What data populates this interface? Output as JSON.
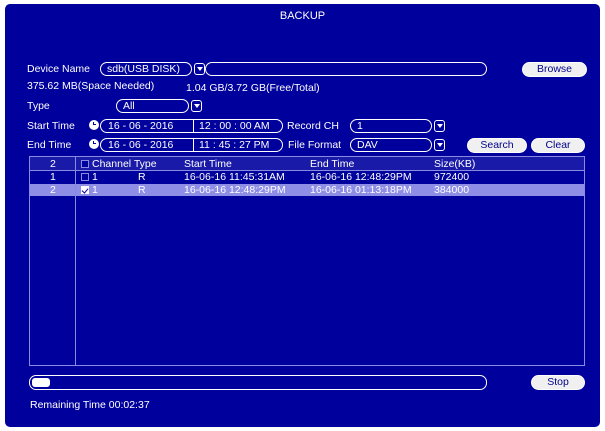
{
  "window": {
    "title": "BACKUP"
  },
  "device": {
    "label": "Device Name",
    "value": "sdb(USB DISK)",
    "path_value": "",
    "browse_label": "Browse",
    "space_needed": "375.62 MB(Space Needed)",
    "free_total": "1.04 GB/3.72 GB(Free/Total)"
  },
  "filters": {
    "type_label": "Type",
    "type_value": "All",
    "start_label": "Start Time",
    "start": {
      "date": "16 - 06 - 2016",
      "time": "12 : 00 : 00 AM"
    },
    "end_label": "End Time",
    "end": {
      "date": "16 - 06 - 2016",
      "time": "11 : 45 : 27 PM"
    },
    "record_ch_label": "Record CH",
    "record_ch_value": "1",
    "file_format_label": "File Format",
    "file_format_value": "DAV",
    "search_label": "Search",
    "clear_label": "Clear"
  },
  "table": {
    "count": "2",
    "columns": [
      "Channel Type",
      "Start Time",
      "End Time",
      "Size(KB)"
    ],
    "rows": [
      {
        "index": "1",
        "checked": false,
        "selected": false,
        "channel": "1",
        "type": "R",
        "start": "16-06-16 11:45:31AM",
        "end": "16-06-16 12:48:29PM",
        "size": "972400"
      },
      {
        "index": "2",
        "checked": true,
        "selected": true,
        "channel": "1",
        "type": "R",
        "start": "16-06-16 12:48:29PM",
        "end": "16-06-16 01:13:18PM",
        "size": "384000"
      }
    ]
  },
  "progress": {
    "fraction": 0.04
  },
  "stop_label": "Stop",
  "remaining": "Remaining Time 00:02:37",
  "colors": {
    "background": "#00009c",
    "selected_row": "#8e8ee6",
    "button": "#f0f0f0",
    "text": "#ffffff"
  }
}
